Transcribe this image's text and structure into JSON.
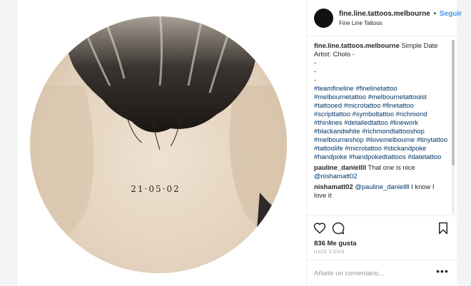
{
  "post": {
    "username": "fine.line.tattoos.melbourne",
    "separator": "•",
    "follow_label": "Seguir",
    "location": "Fine Line Tattoos",
    "tattoo_text": "21·05·02"
  },
  "caption": {
    "username": "fine.line.tattoos.melbourne",
    "text": " Simple Date Artist: Cholo -",
    "dashes": [
      "-",
      "-",
      "-"
    ],
    "hashtags": "#teamfineline #finelinetattoo #melbournetattoo #melbournetattooist #tattooed #microtattoo #finetattoo #scripttattoo #symboltattoo #richmond #thinlines #detailedtattoo #linework #blackandwhite #richmondtattooshop #melbourneshop #ilovemelbourne #tinytattoo #tattoolife #microtattoo #stickandpoke #handpoke #handpokedtattoos #datetattoo"
  },
  "comments": [
    {
      "username": "pauline_daniellll",
      "text": " That one is nice ",
      "mention": "@nishamatt02"
    },
    {
      "username": "nishamatt02",
      "mention": " @pauline_daniellll",
      "text": " I know I love it"
    }
  ],
  "actions": {
    "like_icon": "heart-icon",
    "comment_icon": "comment-icon",
    "save_icon": "bookmark-icon"
  },
  "likes": "836 Me gusta",
  "timestamp": "HACE 3 DÍAS",
  "add_comment": {
    "placeholder": "Añade un comentario...",
    "more_label": "•••"
  },
  "colors": {
    "link": "#3897f0",
    "hashtag": "#003569",
    "border": "#efefef"
  }
}
